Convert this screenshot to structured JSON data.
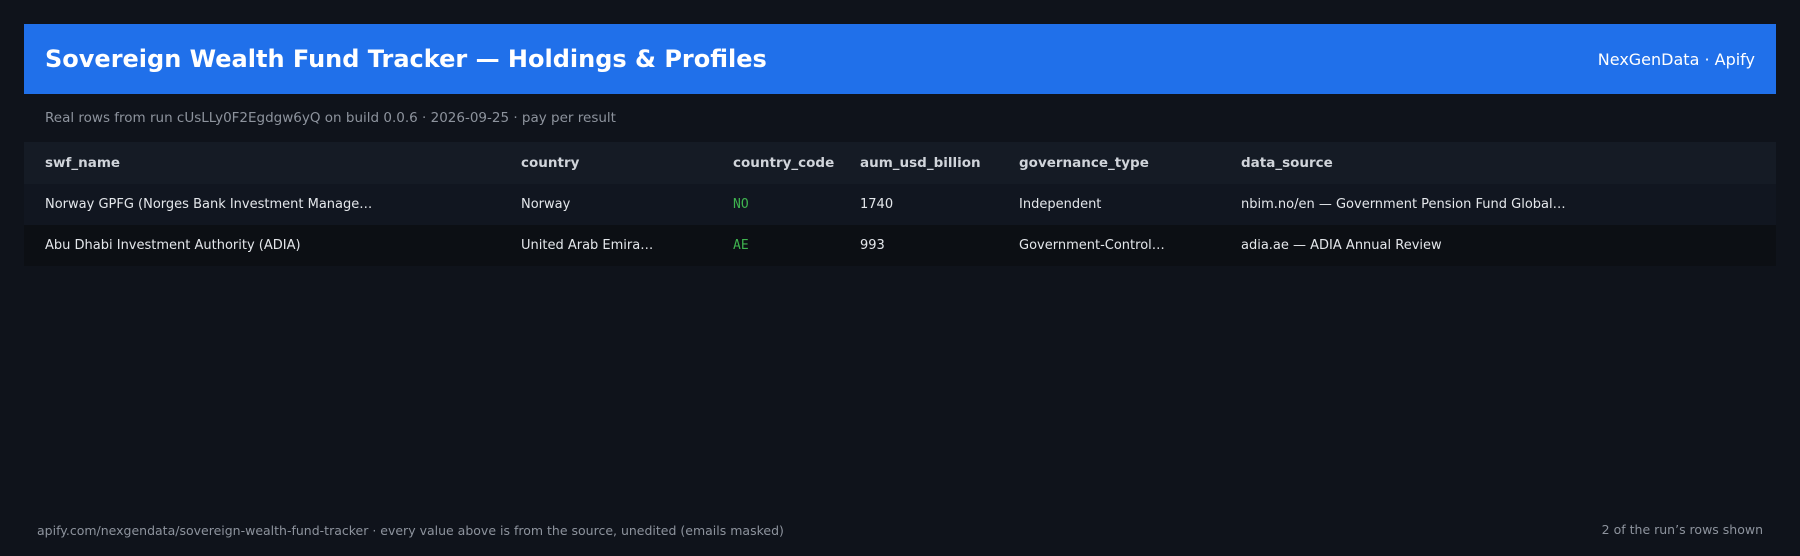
{
  "header": {
    "title": "Sovereign Wealth Fund Tracker — Holdings & Profiles",
    "brand": "NexGenData · Apify"
  },
  "subtitle": "Real rows from run cUsLLy0F2Egdgw6yQ on build 0.0.6 · 2026-09-25 · pay per result",
  "table": {
    "columns": [
      "swf_name",
      "country",
      "country_code",
      "aum_usd_billion",
      "governance_type",
      "data_source"
    ],
    "rows": [
      [
        "Norway GPFG (Norges Bank Investment Manage…",
        "Norway",
        "NO",
        "1740",
        "Independent",
        "nbim.no/en — Government Pension Fund Global…"
      ],
      [
        "Abu Dhabi Investment Authority (ADIA)",
        "United Arab Emira…",
        "AE",
        "993",
        "Government-Control…",
        "adia.ae — ADIA Annual Review"
      ]
    ]
  },
  "footer": {
    "left": "apify.com/nexgendata/sovereign-wealth-fund-tracker  ·  every value above is from the source, unedited (emails masked)",
    "right": "2 of the run’s rows shown"
  },
  "colors": {
    "header_bg": "#2070ea",
    "page_bg": "#0f131b",
    "code_text": "#3fb34f"
  }
}
